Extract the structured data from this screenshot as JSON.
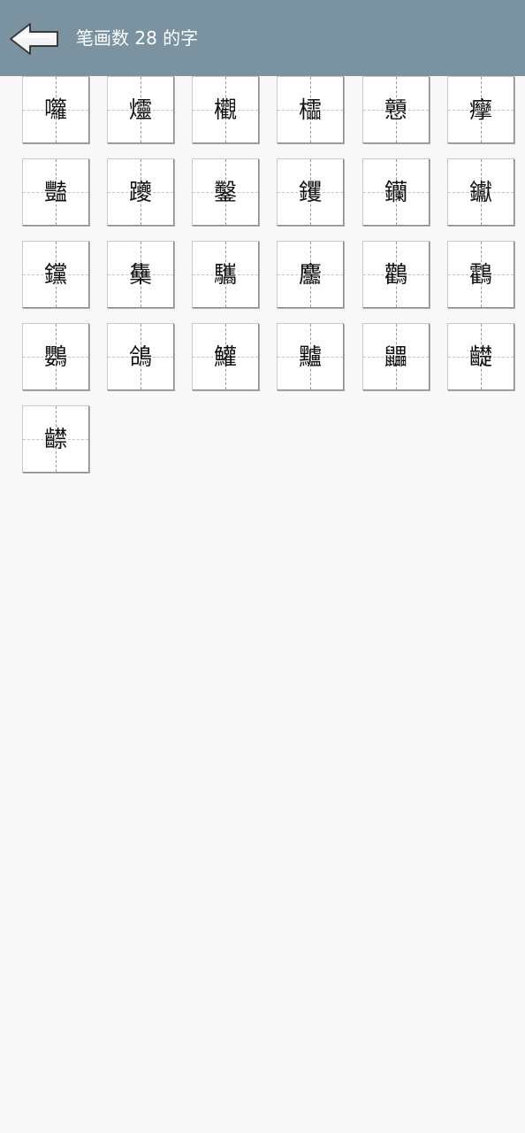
{
  "header": {
    "back_icon": "back-arrow-icon",
    "title": "笔画数 28 的字",
    "background": "#7b92a0"
  },
  "characters": [
    "囖",
    "爧",
    "欟",
    "櫺",
    "戅",
    "癴",
    "豔",
    "躨",
    "鑿",
    "钁",
    "钄",
    "钀",
    "钂",
    "雧",
    "驨",
    "麢",
    "鸛",
    "鸖",
    "鸚",
    "鴿",
    "鱹",
    "黸",
    "鼺",
    "齼",
    "齽"
  ]
}
